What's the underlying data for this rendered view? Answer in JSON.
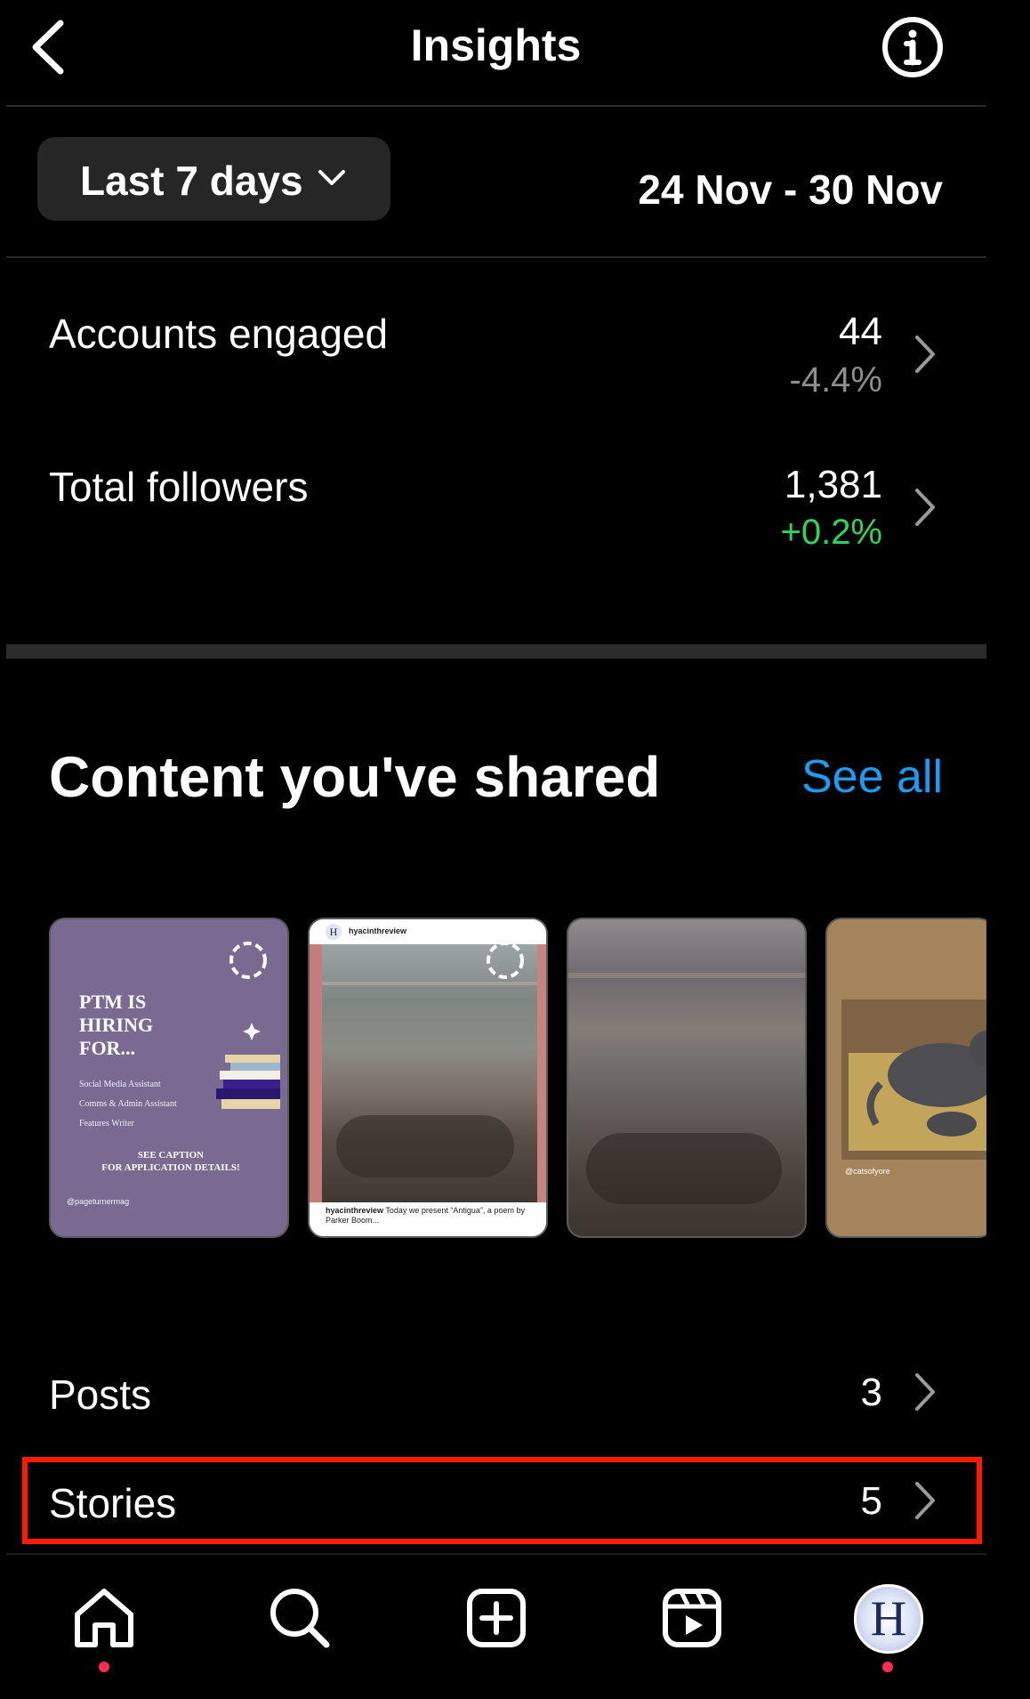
{
  "header": {
    "title": "Insights",
    "back_icon": "chevron-left-icon",
    "info_icon": "info-icon"
  },
  "range": {
    "selected": "Last 7 days",
    "dates": "24 Nov - 30 Nov"
  },
  "metrics": [
    {
      "label": "Accounts engaged",
      "value": "44",
      "delta": "-4.4%",
      "delta_color": "#8e8e8e"
    },
    {
      "label": "Total followers",
      "value": "1,381",
      "delta": "+0.2%",
      "delta_color": "#2fd55a"
    }
  ],
  "content": {
    "title": "Content you've shared",
    "see_all": "See all",
    "thumbnails": [
      {
        "heading_lines": [
          "PTM IS",
          "HIRING",
          "FOR..."
        ],
        "roles": [
          "Social Media Assistant",
          "Comms & Admin Assistant",
          "Features Writer"
        ],
        "cta_lines": [
          "SEE CAPTION",
          "FOR APPLICATION DETAILS!"
        ],
        "handle": "@pageturnermag"
      },
      {
        "account": "hyacinthreview",
        "caption_user": "hyacinthreview",
        "caption_text": "Today we present “Antigua”, a poem by Parker Boom..."
      },
      {},
      {
        "handle": "@catsofyore"
      }
    ]
  },
  "counts": [
    {
      "label": "Posts",
      "value": "3"
    },
    {
      "label": "Stories",
      "value": "5"
    }
  ],
  "nav": {
    "items": [
      "home-icon",
      "search-icon",
      "create-icon",
      "reels-icon",
      "profile-avatar"
    ],
    "avatar_letter": "H",
    "active_dot_color": "#ff2d55"
  },
  "accent_colors": {
    "link": "#1d9bf0",
    "highlight": "#ff1a00"
  }
}
